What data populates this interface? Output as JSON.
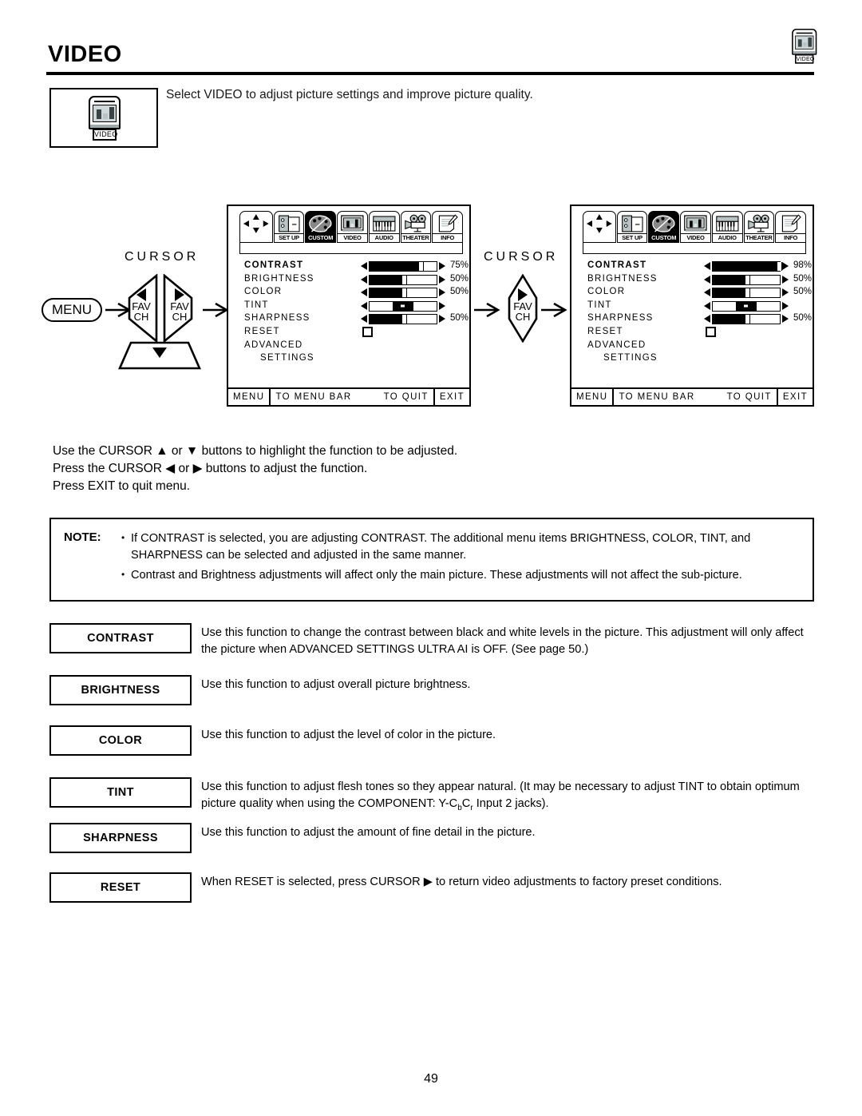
{
  "page": {
    "title": "VIDEO",
    "number": "49",
    "intro": "Select VIDEO to adjust picture settings and improve picture quality.",
    "icon_label": "VIDEO"
  },
  "nav": {
    "cursor_label": "CURSOR",
    "menu_label": "MENU",
    "fav_label_line1": "FAV",
    "fav_label_line2": "CH"
  },
  "instructions": [
    "Use the CURSOR ▲ or ▼ buttons to highlight the function to be adjusted.",
    "Press the CURSOR ◀ or ▶ buttons to adjust the function.",
    "Press EXIT to quit menu."
  ],
  "osd": {
    "tabs": [
      {
        "label": "",
        "icon": "cursor-pad-icon",
        "selected": false
      },
      {
        "label": "SET UP",
        "icon": "setup-icon",
        "selected": false
      },
      {
        "label": "CUSTOM",
        "icon": "palette-icon",
        "selected": true
      },
      {
        "label": "VIDEO",
        "icon": "video-icon",
        "selected": false
      },
      {
        "label": "AUDIO",
        "icon": "audio-keyboard-icon",
        "selected": false
      },
      {
        "label": "THEATER",
        "icon": "movie-projector-icon",
        "selected": false
      },
      {
        "label": "INFO",
        "icon": "info-document-icon",
        "selected": false
      }
    ],
    "footer": {
      "menu": "MENU",
      "to_menu_bar": "TO MENU BAR",
      "to_quit": "TO QUIT",
      "exit": "EXIT"
    },
    "left": {
      "rows": [
        {
          "label": "CONTRAST",
          "type": "slider",
          "value": 75,
          "pct": "75%",
          "selected": true
        },
        {
          "label": "BRIGHTNESS",
          "type": "slider",
          "value": 50,
          "pct": "50%",
          "selected": false
        },
        {
          "label": "COLOR",
          "type": "slider",
          "value": 50,
          "pct": "50%",
          "selected": false
        },
        {
          "label": "TINT",
          "type": "tint",
          "value": 50,
          "pct": "",
          "selected": false
        },
        {
          "label": "SHARPNESS",
          "type": "slider",
          "value": 50,
          "pct": "50%",
          "selected": false
        },
        {
          "label": "RESET",
          "type": "checkbox",
          "value": 0,
          "pct": "",
          "selected": false
        },
        {
          "label": "ADVANCED",
          "type": "text",
          "value": 0,
          "pct": "",
          "selected": false
        },
        {
          "label": "SETTINGS",
          "type": "text-indent",
          "value": 0,
          "pct": "",
          "selected": false
        }
      ]
    },
    "right": {
      "rows": [
        {
          "label": "CONTRAST",
          "type": "slider",
          "value": 98,
          "pct": "98%",
          "selected": true
        },
        {
          "label": "BRIGHTNESS",
          "type": "slider",
          "value": 50,
          "pct": "50%",
          "selected": false
        },
        {
          "label": "COLOR",
          "type": "slider",
          "value": 50,
          "pct": "50%",
          "selected": false
        },
        {
          "label": "TINT",
          "type": "tint",
          "value": 50,
          "pct": "",
          "selected": false
        },
        {
          "label": "SHARPNESS",
          "type": "slider",
          "value": 50,
          "pct": "50%",
          "selected": false
        },
        {
          "label": "RESET",
          "type": "checkbox",
          "value": 0,
          "pct": "",
          "selected": false
        },
        {
          "label": "ADVANCED",
          "type": "text",
          "value": 0,
          "pct": "",
          "selected": false
        },
        {
          "label": "SETTINGS",
          "type": "text-indent",
          "value": 0,
          "pct": "",
          "selected": false
        }
      ]
    }
  },
  "note": {
    "label": "NOTE:",
    "items": [
      "If CONTRAST is selected, you are adjusting CONTRAST.  The additional menu items BRIGHTNESS, COLOR, TINT, and SHARPNESS can be selected and adjusted in the same manner.",
      "Contrast and Brightness adjustments will affect only the main picture. These adjustments will not affect the sub-picture."
    ]
  },
  "functions": [
    {
      "key": "CONTRAST",
      "desc": "Use this function to change the contrast between black and white levels in the picture.  This adjustment will only affect the picture when ADVANCED SETTINGS ULTRA AI is OFF. (See page 50.)"
    },
    {
      "key": "BRIGHTNESS",
      "desc": "Use this function to adjust overall picture brightness."
    },
    {
      "key": "COLOR",
      "desc": "Use this function to adjust the level of color in the picture."
    },
    {
      "key": "TINT",
      "desc_pre": "Use this function to adjust flesh tones so they appear natural. (It may be necessary to adjust TINT to obtain optimum picture quality when using the COMPONENT: Y-C",
      "desc_sub1": "b",
      "desc_mid": "C",
      "desc_sub2": "r",
      "desc_post": " Input 2 jacks)."
    },
    {
      "key": "SHARPNESS",
      "desc": "Use this function to adjust the amount of fine detail in the picture."
    },
    {
      "key": "RESET",
      "desc": "When RESET is selected, press CURSOR ▶ to return video adjustments to factory preset conditions."
    }
  ]
}
